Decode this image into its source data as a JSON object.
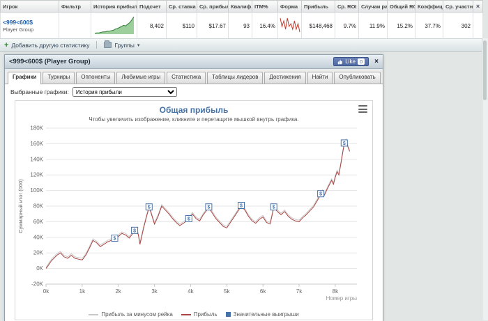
{
  "table": {
    "headers": [
      "Игрок",
      "Фильтр",
      "История прибыли",
      "Подсчет",
      "Ср. ставка",
      "Ср. прибыль",
      "Квалиф...",
      "ITM%",
      "Форма",
      "Прибыль",
      "Ср. ROI",
      "Случаи ра...",
      "Общий ROI",
      "Коэффици...",
      "Ср. участни..."
    ],
    "close_label": "×",
    "row": {
      "player_name": "<999<600$",
      "player_type": "Player Group",
      "count": "8,402",
      "avg_stake": "$110",
      "avg_profit": "$17.67",
      "ability": "93",
      "itm_pct": "16.4%",
      "profit": "$148,468",
      "avg_roi": "9.7%",
      "cases_pct": "11.9%",
      "total_roi": "15.2%",
      "coefficient": "37.7%",
      "avg_entrants": "302",
      "profit_sparkline": [
        0,
        1,
        1,
        2,
        3,
        3,
        4,
        4,
        5,
        6,
        8,
        9,
        11,
        13,
        15,
        14,
        17,
        20,
        25,
        31
      ],
      "form_sparkline": [
        6,
        3,
        5,
        2,
        6,
        3,
        4,
        2,
        5,
        2,
        4,
        1
      ]
    }
  },
  "toolbar": {
    "add_stat_label": "Добавить другую статистику",
    "groups_label": "Группы"
  },
  "panel": {
    "title": "<999<600$ (Player Group)",
    "like_label": "Like",
    "like_count": "0",
    "close_label": "×",
    "tabs": [
      {
        "label": "Графики",
        "active": true
      },
      {
        "label": "Турниры",
        "active": false
      },
      {
        "label": "Оппоненты",
        "active": false
      },
      {
        "label": "Любимые игры",
        "active": false
      },
      {
        "label": "Статистика",
        "active": false
      },
      {
        "label": "Таблицы лидеров",
        "active": false
      },
      {
        "label": "Достижения",
        "active": false
      },
      {
        "label": "Найти",
        "active": false
      },
      {
        "label": "Опубликовать",
        "active": false
      }
    ],
    "selected_graphs_label": "Выбранные графики:",
    "graph_select_value": "История прибыли"
  },
  "chart_data": {
    "type": "line",
    "title": "Общая прибыль",
    "subtitle": "Чтобы увеличить изображение, кликните и перетащите мышкой внутрь графика.",
    "ylabel": "Суммарный итог (000)",
    "xlabel": "Номер игры",
    "ylim": [
      -20,
      180
    ],
    "xlim": [
      0,
      8.6
    ],
    "ytick_suffix": "K",
    "yticks": [
      -20,
      0,
      20,
      40,
      60,
      80,
      100,
      120,
      140,
      160,
      180
    ],
    "xticks": [
      "0k",
      "1k",
      "2k",
      "3k",
      "4k",
      "5k",
      "6k",
      "7k",
      "8k"
    ],
    "grid": true,
    "legend_position": "bottom",
    "series": [
      {
        "name": "Прибыль за минусом рейка",
        "color": "#c8c8c8",
        "points": [
          [
            0,
            1
          ],
          [
            0.05,
            5
          ],
          [
            0.15,
            12
          ],
          [
            0.3,
            19
          ],
          [
            0.4,
            22
          ],
          [
            0.5,
            17
          ],
          [
            0.6,
            15
          ],
          [
            0.7,
            19
          ],
          [
            0.8,
            15
          ],
          [
            0.9,
            14
          ],
          [
            1,
            13
          ],
          [
            1.1,
            19
          ],
          [
            1.2,
            28
          ],
          [
            1.3,
            38
          ],
          [
            1.4,
            35
          ],
          [
            1.5,
            30
          ],
          [
            1.6,
            33
          ],
          [
            1.7,
            36
          ],
          [
            1.8,
            38
          ],
          [
            1.9,
            40
          ],
          [
            2,
            43
          ],
          [
            2.1,
            47
          ],
          [
            2.2,
            45
          ],
          [
            2.3,
            41
          ],
          [
            2.45,
            50
          ],
          [
            2.55,
            46
          ],
          [
            2.6,
            33
          ],
          [
            2.7,
            54
          ],
          [
            2.8,
            72
          ],
          [
            2.85,
            80
          ],
          [
            2.9,
            74
          ],
          [
            3,
            59
          ],
          [
            3.1,
            69
          ],
          [
            3.2,
            82
          ],
          [
            3.3,
            77
          ],
          [
            3.4,
            72
          ],
          [
            3.5,
            66
          ],
          [
            3.6,
            61
          ],
          [
            3.7,
            57
          ],
          [
            3.8,
            60
          ],
          [
            3.95,
            65
          ],
          [
            4.05,
            72
          ],
          [
            4.15,
            66
          ],
          [
            4.25,
            63
          ],
          [
            4.35,
            71
          ],
          [
            4.5,
            80
          ],
          [
            4.6,
            73
          ],
          [
            4.7,
            66
          ],
          [
            4.8,
            61
          ],
          [
            4.9,
            56
          ],
          [
            5,
            54
          ],
          [
            5.1,
            61
          ],
          [
            5.2,
            68
          ],
          [
            5.3,
            75
          ],
          [
            5.4,
            82
          ],
          [
            5.5,
            77
          ],
          [
            5.6,
            69
          ],
          [
            5.7,
            63
          ],
          [
            5.8,
            60
          ],
          [
            5.9,
            65
          ],
          [
            6,
            68
          ],
          [
            6.1,
            61
          ],
          [
            6.2,
            59
          ],
          [
            6.3,
            80
          ],
          [
            6.4,
            75
          ],
          [
            6.5,
            71
          ],
          [
            6.6,
            75
          ],
          [
            6.7,
            69
          ],
          [
            6.8,
            65
          ],
          [
            6.9,
            63
          ],
          [
            7,
            62
          ],
          [
            7.1,
            67
          ],
          [
            7.2,
            71
          ],
          [
            7.3,
            76
          ],
          [
            7.4,
            81
          ],
          [
            7.5,
            89
          ],
          [
            7.6,
            97
          ],
          [
            7.65,
            101
          ],
          [
            7.7,
            96
          ],
          [
            7.8,
            106
          ],
          [
            7.9,
            115
          ],
          [
            7.95,
            110
          ],
          [
            8,
            119
          ],
          [
            8.05,
            126
          ],
          [
            8.1,
            122
          ],
          [
            8.15,
            135
          ],
          [
            8.2,
            149
          ],
          [
            8.25,
            162
          ],
          [
            8.3,
            166
          ],
          [
            8.35,
            158
          ],
          [
            8.4,
            152
          ]
        ]
      },
      {
        "name": "Прибыль",
        "color": "#a94442",
        "points": [
          [
            0,
            0
          ],
          [
            0.05,
            3
          ],
          [
            0.15,
            10
          ],
          [
            0.3,
            17
          ],
          [
            0.4,
            20
          ],
          [
            0.5,
            15
          ],
          [
            0.6,
            13
          ],
          [
            0.7,
            17
          ],
          [
            0.8,
            13
          ],
          [
            0.9,
            12
          ],
          [
            1,
            11
          ],
          [
            1.1,
            17
          ],
          [
            1.2,
            26
          ],
          [
            1.3,
            36
          ],
          [
            1.4,
            33
          ],
          [
            1.5,
            28
          ],
          [
            1.6,
            31
          ],
          [
            1.7,
            34
          ],
          [
            1.8,
            36
          ],
          [
            1.9,
            38
          ],
          [
            2,
            41
          ],
          [
            2.1,
            45
          ],
          [
            2.2,
            43
          ],
          [
            2.3,
            39
          ],
          [
            2.45,
            48
          ],
          [
            2.55,
            44
          ],
          [
            2.6,
            31
          ],
          [
            2.7,
            52
          ],
          [
            2.8,
            70
          ],
          [
            2.85,
            78
          ],
          [
            2.9,
            72
          ],
          [
            3,
            57
          ],
          [
            3.1,
            67
          ],
          [
            3.2,
            80
          ],
          [
            3.3,
            75
          ],
          [
            3.4,
            70
          ],
          [
            3.5,
            64
          ],
          [
            3.6,
            59
          ],
          [
            3.7,
            55
          ],
          [
            3.8,
            58
          ],
          [
            3.95,
            63
          ],
          [
            4.05,
            70
          ],
          [
            4.15,
            64
          ],
          [
            4.25,
            61
          ],
          [
            4.35,
            69
          ],
          [
            4.5,
            78
          ],
          [
            4.6,
            71
          ],
          [
            4.7,
            64
          ],
          [
            4.8,
            59
          ],
          [
            4.9,
            54
          ],
          [
            5,
            52
          ],
          [
            5.1,
            59
          ],
          [
            5.2,
            66
          ],
          [
            5.3,
            73
          ],
          [
            5.4,
            80
          ],
          [
            5.5,
            75
          ],
          [
            5.6,
            67
          ],
          [
            5.7,
            61
          ],
          [
            5.8,
            58
          ],
          [
            5.9,
            63
          ],
          [
            6,
            66
          ],
          [
            6.1,
            59
          ],
          [
            6.2,
            57
          ],
          [
            6.3,
            78
          ],
          [
            6.4,
            73
          ],
          [
            6.5,
            69
          ],
          [
            6.6,
            73
          ],
          [
            6.7,
            67
          ],
          [
            6.8,
            63
          ],
          [
            6.9,
            61
          ],
          [
            7,
            60
          ],
          [
            7.1,
            65
          ],
          [
            7.2,
            69
          ],
          [
            7.3,
            74
          ],
          [
            7.4,
            79
          ],
          [
            7.5,
            87
          ],
          [
            7.6,
            95
          ],
          [
            7.65,
            99
          ],
          [
            7.7,
            94
          ],
          [
            7.8,
            104
          ],
          [
            7.9,
            113
          ],
          [
            7.95,
            108
          ],
          [
            8,
            117
          ],
          [
            8.05,
            124
          ],
          [
            8.1,
            120
          ],
          [
            8.15,
            133
          ],
          [
            8.2,
            147
          ],
          [
            8.25,
            160
          ],
          [
            8.3,
            164
          ],
          [
            8.35,
            156
          ],
          [
            8.4,
            150
          ]
        ]
      }
    ],
    "markers": {
      "name": "Значительные выигрыши",
      "color": "#4572a7",
      "symbol": "$",
      "points": [
        [
          1.9,
          38
        ],
        [
          2.45,
          48
        ],
        [
          2.85,
          78
        ],
        [
          3.95,
          63
        ],
        [
          4.5,
          78
        ],
        [
          5.4,
          80
        ],
        [
          6.3,
          78
        ],
        [
          7.6,
          95
        ],
        [
          8.25,
          160
        ]
      ]
    }
  }
}
